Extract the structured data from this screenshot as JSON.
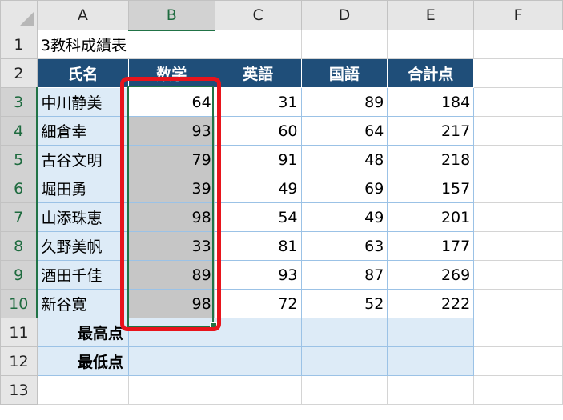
{
  "columns": [
    "A",
    "B",
    "C",
    "D",
    "E",
    "F"
  ],
  "rows": [
    "1",
    "2",
    "3",
    "4",
    "5",
    "6",
    "7",
    "8",
    "9",
    "10",
    "11",
    "12",
    "13"
  ],
  "sheet_title": "3教科成績表",
  "headers": [
    "氏名",
    "数学",
    "英語",
    "国語",
    "合計点"
  ],
  "students": [
    {
      "name": "中川静美",
      "math": "64",
      "english": "31",
      "japanese": "89",
      "total": "184"
    },
    {
      "name": "細倉幸",
      "math": "93",
      "english": "60",
      "japanese": "64",
      "total": "217"
    },
    {
      "name": "古谷文明",
      "math": "79",
      "english": "91",
      "japanese": "48",
      "total": "218"
    },
    {
      "name": "堀田勇",
      "math": "39",
      "english": "49",
      "japanese": "69",
      "total": "157"
    },
    {
      "name": "山添珠恵",
      "math": "98",
      "english": "54",
      "japanese": "49",
      "total": "201"
    },
    {
      "name": "久野美帆",
      "math": "33",
      "english": "81",
      "japanese": "63",
      "total": "177"
    },
    {
      "name": "酒田千佳",
      "math": "89",
      "english": "93",
      "japanese": "87",
      "total": "269"
    },
    {
      "name": "新谷寛",
      "math": "98",
      "english": "72",
      "japanese": "52",
      "total": "222"
    }
  ],
  "summary": {
    "max_label": "最高点",
    "min_label": "最低点"
  },
  "colors": {
    "header_fill": "#1f4e79",
    "name_fill": "#ddebf7",
    "selection": "#217346",
    "highlight": "#e8141c"
  }
}
